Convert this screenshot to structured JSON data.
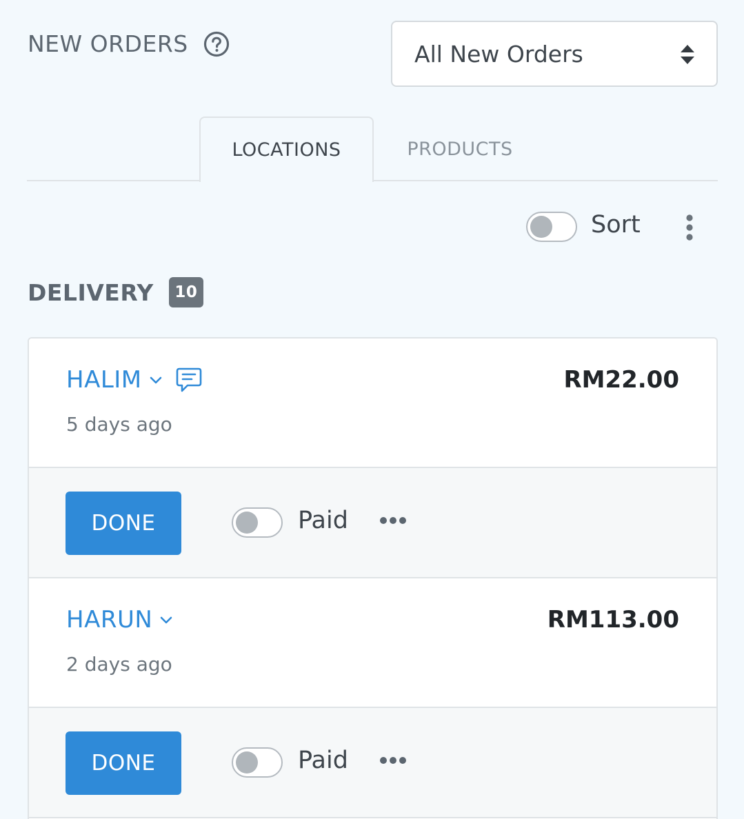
{
  "header": {
    "title": "NEW ORDERS",
    "help_icon": "question-circle-icon"
  },
  "filter": {
    "selected": "All New Orders",
    "icon": "sort-arrows-icon"
  },
  "tabs": [
    {
      "label": "LOCATIONS",
      "active": true
    },
    {
      "label": "PRODUCTS",
      "active": false
    }
  ],
  "toolbar": {
    "sort_label": "Sort",
    "sort_on": false,
    "menu_icon": "vertical-dots-icon"
  },
  "section": {
    "title": "DELIVERY",
    "count": "10"
  },
  "orders": [
    {
      "customer": "HALIM",
      "has_note": true,
      "price": "RM22.00",
      "time": "5 days ago",
      "done_label": "DONE",
      "paid_label": "Paid",
      "paid": false
    },
    {
      "customer": "HARUN",
      "has_note": false,
      "price": "RM113.00",
      "time": "2 days ago",
      "done_label": "DONE",
      "paid_label": "Paid",
      "paid": false
    }
  ],
  "colors": {
    "accent": "#2f8ad8",
    "background": "#f3f9fd",
    "badge": "#6b747c"
  }
}
